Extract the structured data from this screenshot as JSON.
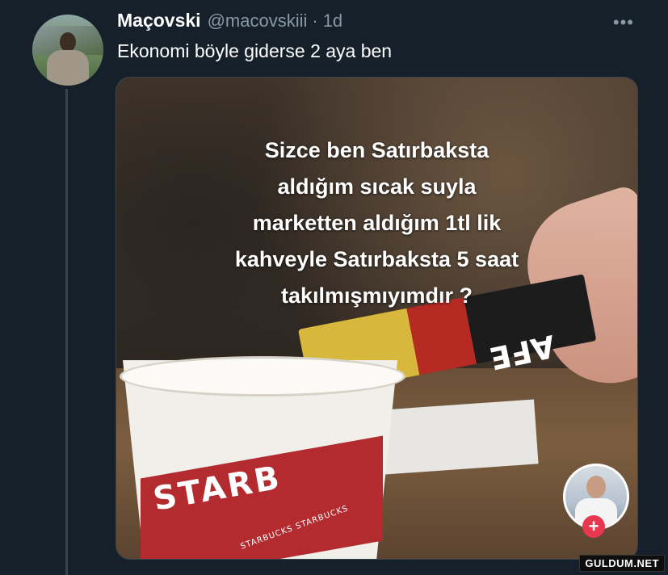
{
  "colors": {
    "background": "#15202b",
    "text_primary": "#ffffff",
    "text_secondary": "#8899a6",
    "thread_line": "#38444d",
    "follow_button": "#e8384f"
  },
  "tweet": {
    "display_name": "Maçovski",
    "handle": "@macovskiii",
    "separator": "·",
    "time": "1d",
    "more_icon": "more-horizontal-icon",
    "text": "Ekonomi böyle giderse 2 aya ben"
  },
  "media": {
    "caption_lines": [
      "Sizce ben Satırbaksta",
      "aldığım sıcak suyla",
      "marketten aldığım 1tl lik",
      "kahveyle Satırbaksta 5 saat",
      "takılmışmıyımdır ?"
    ],
    "cup_brand": "STARB",
    "cup_brand_small": "STARBUCKS STARBUCKS",
    "stick_label": "AFE",
    "follow_icon": "plus-icon",
    "follow_symbol": "+"
  },
  "watermark": "GULDUM.NET"
}
